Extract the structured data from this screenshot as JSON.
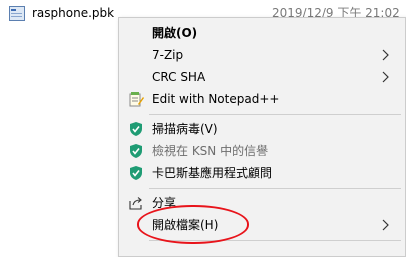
{
  "file": {
    "name": "rasphone.pbk",
    "modified": "2019/12/9 下午 21:02",
    "icon": "file-icon"
  },
  "menu": {
    "open": "開啟(O)",
    "seven_zip": "7-Zip",
    "crc_sha": "CRC SHA",
    "edit_notepad": "Edit with Notepad++",
    "scan_virus": "掃描病毒(V)",
    "ksn_check": "檢視在 KSN 中的信譽",
    "kaspersky_consult": "卡巴斯基應用程式顧問",
    "share": "分享",
    "open_with": "開啟檔案(H)"
  },
  "colors": {
    "menu_bg": "#f2f2f2",
    "shield_green": "#1f9c74",
    "highlight_red": "#e8141b"
  }
}
